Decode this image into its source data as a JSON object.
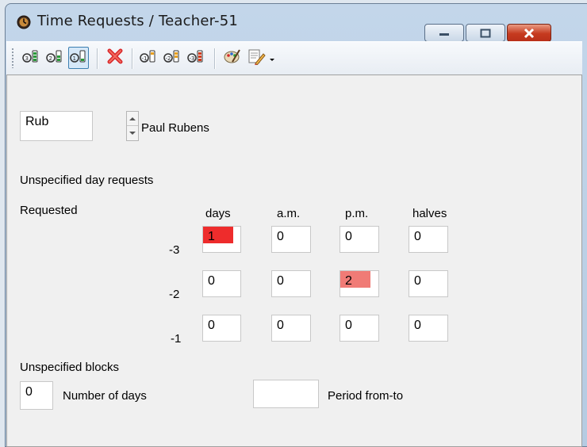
{
  "window": {
    "title": "Time Requests / Teacher-51",
    "icon": "clock-icon",
    "controls": [
      "minimize-icon",
      "maximize-icon",
      "close-icon"
    ]
  },
  "toolbar": {
    "buttons": [
      {
        "icon": "request-level-3-icon",
        "active": false
      },
      {
        "icon": "request-level-2-icon",
        "active": false
      },
      {
        "icon": "request-level-1-icon",
        "active": true
      },
      {
        "icon": "delete-icon",
        "active": false
      },
      {
        "icon": "request-minus-1-icon",
        "active": false
      },
      {
        "icon": "request-minus-2-icon",
        "active": false
      },
      {
        "icon": "request-minus-3-icon",
        "active": false
      },
      {
        "icon": "palette-icon",
        "active": false
      },
      {
        "icon": "print-icon",
        "active": false
      },
      {
        "icon": "dropdown-arrow-icon",
        "active": false
      }
    ]
  },
  "teacher": {
    "short_name": "Rub",
    "full_name": "Paul Rubens"
  },
  "section_unspecified_day": "Unspecified day requests",
  "requested_label": "Requested",
  "columns": [
    "days",
    "a.m.",
    "p.m.",
    "halves"
  ],
  "rows": [
    {
      "level": "-3",
      "values": [
        "1",
        "0",
        "0",
        "0"
      ]
    },
    {
      "level": "-2",
      "values": [
        "0",
        "0",
        "2",
        "0"
      ]
    },
    {
      "level": "-1",
      "values": [
        "0",
        "0",
        "0",
        "0"
      ]
    }
  ],
  "highlight_colors": {
    "strong": "#ee2c2c",
    "medium": "#f07b76"
  },
  "section_unspecified_blocks": "Unspecified blocks",
  "blocks": {
    "number_of_days_value": "0",
    "number_of_days_label": "Number of days",
    "period_value": "",
    "period_label": "Period from-to"
  }
}
